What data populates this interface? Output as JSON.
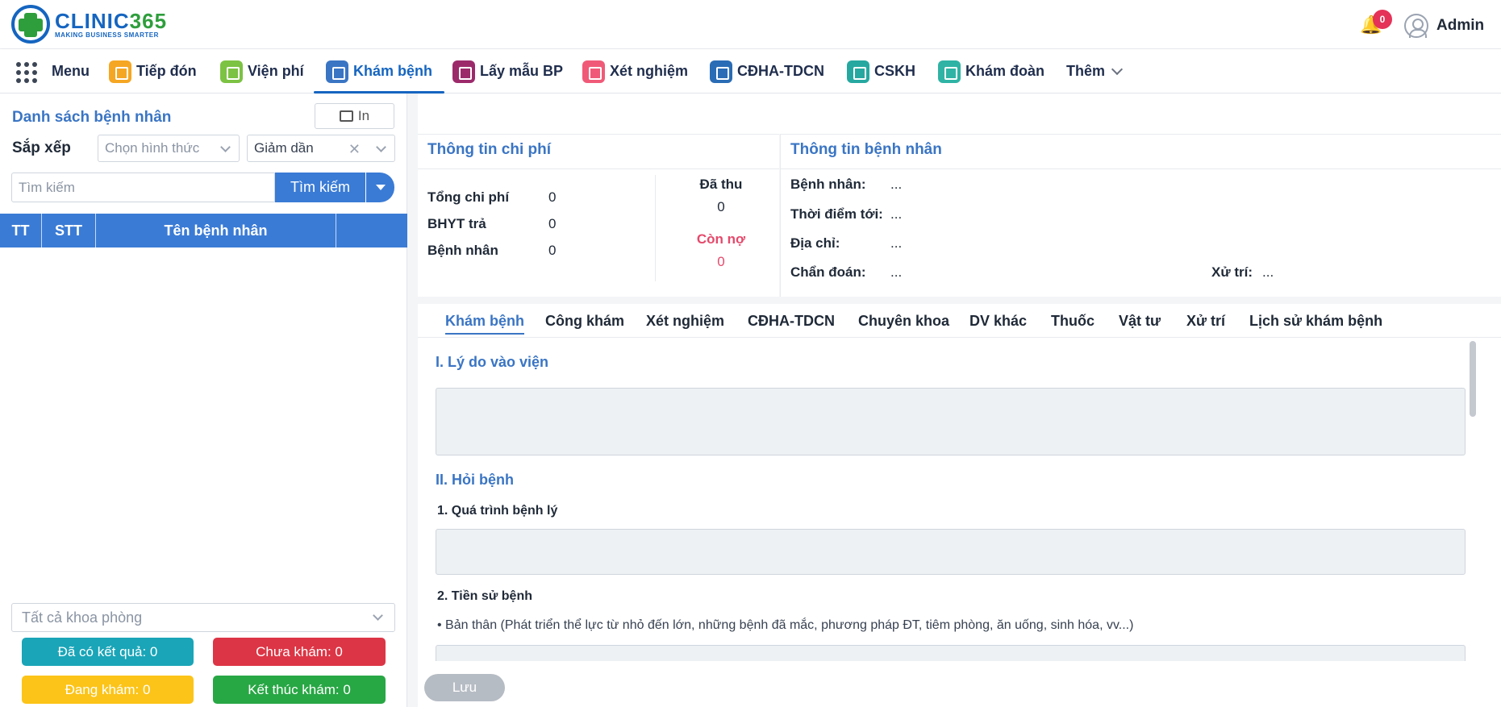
{
  "brand": {
    "name_part1": "CLINIC",
    "name_part2": "365",
    "tagline": "MAKING BUSINESS SMARTER"
  },
  "header": {
    "notification_count": "0",
    "user_name": "Admin"
  },
  "nav": {
    "menu_label": "Menu",
    "items": [
      {
        "label": "Tiếp đón",
        "color": "#f5a623"
      },
      {
        "label": "Viện phí",
        "color": "#7cc243"
      },
      {
        "label": "Khám bệnh",
        "color": "#3a75c4"
      },
      {
        "label": "Lấy mẫu BP",
        "color": "#9c2a6b"
      },
      {
        "label": "Xét nghiệm",
        "color": "#f05a78"
      },
      {
        "label": "CĐHA-TDCN",
        "color": "#2a6cb5"
      },
      {
        "label": "CSKH",
        "color": "#26a8a0"
      },
      {
        "label": "Khám đoàn",
        "color": "#2fb3a4"
      }
    ],
    "more_label": "Thêm"
  },
  "left_panel": {
    "title": "Danh sách bệnh nhân",
    "print_label": "In",
    "sort_label": "Sắp xếp",
    "sort_method_placeholder": "Chọn hình thức",
    "sort_order_value": "Giảm dần",
    "search_placeholder": "Tìm kiếm",
    "search_button": "Tìm kiếm",
    "table_headers": [
      "TT",
      "STT",
      "Tên bệnh nhân",
      ""
    ],
    "department_select": "Tất cả khoa phòng",
    "stats": {
      "has_result": "Đã có kết quả: 0",
      "not_examined": "Chưa khám: 0",
      "examining": "Đang khám: 0",
      "finished": "Kết thúc khám: 0"
    }
  },
  "cost": {
    "title": "Thông tin chi phí",
    "total_label": "Tổng chi phí",
    "total_value": "0",
    "bhyt_label": "BHYT trả",
    "bhyt_value": "0",
    "patient_label": "Bệnh nhân",
    "patient_value": "0",
    "paid_label": "Đã thu",
    "paid_value": "0",
    "debt_label": "Còn nợ",
    "debt_value": "0"
  },
  "patient": {
    "title": "Thông tin bệnh nhân",
    "name_label": "Bệnh nhân:",
    "name_value": "...",
    "time_label": "Thời điểm tới:",
    "time_value": "...",
    "address_label": "Địa chỉ:",
    "address_value": "...",
    "diagnosis_label": "Chẩn đoán:",
    "diagnosis_value": "...",
    "treatment_label": "Xử trí:",
    "treatment_value": "..."
  },
  "exam_tabs": [
    "Khám bệnh",
    "Công khám",
    "Xét nghiệm",
    "CĐHA-TDCN",
    "Chuyên khoa",
    "DV khác",
    "Thuốc",
    "Vật tư",
    "Xử trí",
    "Lịch sử khám bệnh"
  ],
  "exam": {
    "section1": "I. Lý do vào viện",
    "section2": "II. Hỏi bệnh",
    "sub1": "1. Quá trình bệnh lý",
    "sub2": "2. Tiền sử bệnh",
    "note": "• Bản thân (Phát triển thể lực từ nhỏ đến lớn, những bệnh đã mắc, phương pháp ĐT, tiêm phòng, ăn uống, sinh hóa, vv...)",
    "save_label": "Lưu"
  }
}
